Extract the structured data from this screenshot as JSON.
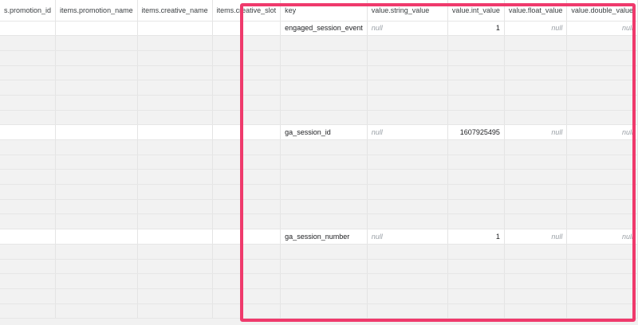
{
  "columns": [
    {
      "key": "promotion_id",
      "label": "items.promotion_id",
      "label_visible": "s.promotion_id"
    },
    {
      "key": "promotion_name",
      "label": "items.promotion_name"
    },
    {
      "key": "creative_name",
      "label": "items.creative_name"
    },
    {
      "key": "creative_slot",
      "label": "items.creative_slot"
    },
    {
      "key": "key",
      "label": "key"
    },
    {
      "key": "string_value",
      "label": "value.string_value"
    },
    {
      "key": "int_value",
      "label": "value.int_value"
    },
    {
      "key": "float_value",
      "label": "value.float_value"
    },
    {
      "key": "double_value",
      "label": "value.double_value"
    }
  ],
  "rows": [
    {
      "key": "engaged_session_event",
      "string_value": "null",
      "int_value": "1",
      "float_value": "null",
      "double_value": "null"
    },
    {
      "key": "ga_session_id",
      "string_value": "null",
      "int_value": "1607925495",
      "float_value": "null",
      "double_value": "null"
    },
    {
      "key": "ga_session_number",
      "string_value": "null",
      "int_value": "1",
      "float_value": "null",
      "double_value": "null"
    }
  ],
  "highlight_color": "#ef3a6c"
}
